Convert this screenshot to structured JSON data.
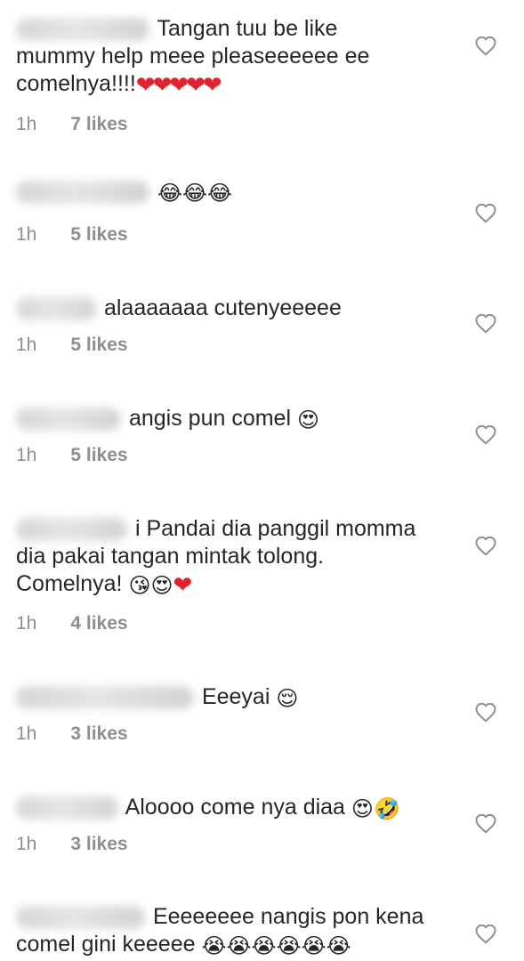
{
  "comments": [
    {
      "text_1": "Tangan tuu be like",
      "text_2": "mummy help meee pleaseeeeee ee",
      "text_3": "comelnya!!!!",
      "emojis": "❤❤❤❤❤",
      "time": "1h",
      "likes": "7 likes"
    },
    {
      "text_1": "",
      "emojis": "😂😂😂",
      "time": "1h",
      "likes": "5 likes"
    },
    {
      "text_1": "alaaaaaaa cutenyeeeee",
      "time": "1h",
      "likes": "5 likes"
    },
    {
      "text_1": "angis pun comel",
      "emojis": "😍",
      "time": "1h",
      "likes": "5 likes"
    },
    {
      "text_1": "i Pandai dia panggil momma",
      "text_2": "dia pakai tangan mintak tolong.",
      "text_3": "Comelnya!",
      "emojis": "😘😍",
      "emojis_2": "❤",
      "time": "1h",
      "likes": "4 likes"
    },
    {
      "text_1": "Eeeyai",
      "emojis": "😌",
      "time": "1h",
      "likes": "3 likes"
    },
    {
      "text_1": "Aloooo come nya diaa",
      "emojis": "😍🤣",
      "time": "1h",
      "likes": "3 likes"
    },
    {
      "text_1": "Eeeeeeee nangis pon kena",
      "text_2": "comel gini keeeee",
      "emojis": "😭😭😭😭😭😭"
    }
  ],
  "icons": {
    "like": "heart-outline-icon"
  },
  "colors": {
    "text": "#262626",
    "meta": "#8e8e8e",
    "heart_outline": "#8e8e8e",
    "red_heart": "#e0242f"
  }
}
